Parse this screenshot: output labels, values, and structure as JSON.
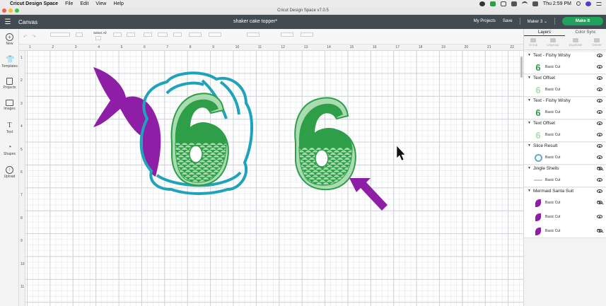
{
  "menubar": {
    "app_name": "Cricut Design Space",
    "items": [
      "File",
      "Edit",
      "View",
      "Help"
    ],
    "clock": "Thu 2:59 PM"
  },
  "window": {
    "title": "Cricut Design Space v7.0.5"
  },
  "header": {
    "canvas_label": "Canvas",
    "project_title": "shaker cake topper*",
    "my_projects": "My Projects",
    "save": "Save",
    "machine": "Maker 3",
    "make_it": "Make It"
  },
  "sidebar": {
    "items": [
      {
        "label": "New",
        "icon": "plus-circle-icon"
      },
      {
        "label": "Templates",
        "icon": "shirt-icon"
      },
      {
        "label": "Projects",
        "icon": "folder-icon"
      },
      {
        "label": "Images",
        "icon": "image-icon"
      },
      {
        "label": "Text",
        "icon": "text-icon"
      },
      {
        "label": "Shapes",
        "icon": "shapes-icon"
      },
      {
        "label": "Upload",
        "icon": "upload-icon"
      }
    ]
  },
  "toolbar": {
    "select_all": "Select All"
  },
  "ruler": {
    "top": [
      "1",
      "2",
      "3",
      "4",
      "5",
      "6",
      "7",
      "8",
      "9",
      "10",
      "11",
      "12",
      "13",
      "14",
      "15",
      "16",
      "17",
      "18",
      "19",
      "20",
      "21",
      "22"
    ],
    "left": [
      "1",
      "2",
      "3",
      "4",
      "5",
      "6",
      "7",
      "8",
      "9",
      "10",
      "11"
    ]
  },
  "layers_panel": {
    "tabs": [
      "Layers",
      "Color Sync"
    ],
    "actions": [
      "Group",
      "Ungroup",
      "Duplicate",
      "Delete"
    ],
    "groups": [
      {
        "name": "Text - Fishy Wishy",
        "visible": true,
        "layers": [
          {
            "label": "Basic Cut",
            "thumb": "6",
            "color": "#2e9e48",
            "visible": true
          }
        ]
      },
      {
        "name": "Text Offset",
        "visible": true,
        "layers": [
          {
            "label": "Basic Cut",
            "thumb": "6",
            "color": "#a9dcb0",
            "visible": true
          }
        ]
      },
      {
        "name": "Text - Fishy Wishy",
        "visible": true,
        "layers": [
          {
            "label": "Basic Cut",
            "thumb": "6",
            "color": "#2e9e48",
            "visible": true
          }
        ]
      },
      {
        "name": "Text Offset",
        "visible": true,
        "layers": [
          {
            "label": "Basic Cut",
            "thumb": "6",
            "color": "#a9dcb0",
            "visible": true
          }
        ]
      },
      {
        "name": "Slice Result",
        "visible": true,
        "layers": [
          {
            "label": "Basic Cut",
            "thumb": "shell",
            "color": "#5bb0c9",
            "visible": true
          }
        ]
      },
      {
        "name": "Jingle Shells",
        "visible": false,
        "layers": [
          {
            "label": "Basic Cut",
            "thumb": "dash",
            "color": "#cccccc",
            "visible": true
          }
        ]
      },
      {
        "name": "Mermaid Santa Suit",
        "visible": true,
        "layers": [
          {
            "label": "Basic Cut",
            "thumb": "tail",
            "color": "#8e1ea6",
            "visible": false
          },
          {
            "label": "Basic Cut",
            "thumb": "tail",
            "color": "#8e1ea6",
            "visible": true
          },
          {
            "label": "Basic Cut",
            "thumb": "tail",
            "color": "#8e1ea6",
            "visible": false
          }
        ]
      }
    ]
  },
  "colors": {
    "header_bg": "#424a52",
    "make_it": "#1fa35a",
    "green_dark": "#2e9e48",
    "green_light": "#a9dcb0",
    "teal": "#1fa3bd",
    "purple": "#8e1ea6"
  }
}
